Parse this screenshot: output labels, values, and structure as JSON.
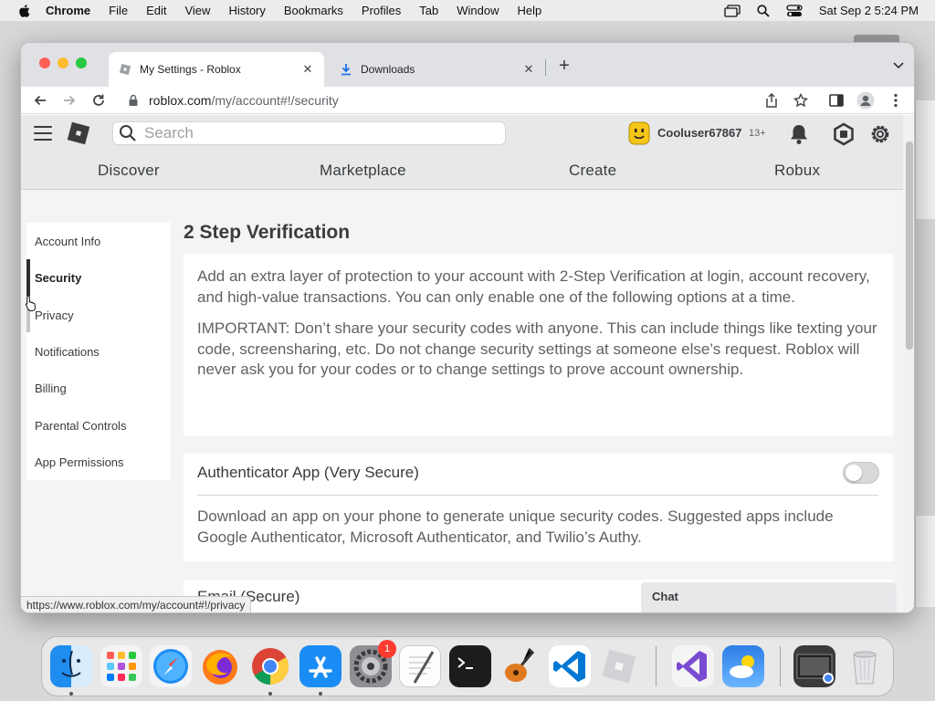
{
  "menubar": {
    "app": "Chrome",
    "items": [
      "File",
      "Edit",
      "View",
      "History",
      "Bookmarks",
      "Profiles",
      "Tab",
      "Window",
      "Help"
    ],
    "clock": "Sat Sep 2  5:24 PM"
  },
  "browser": {
    "tabs": [
      {
        "title": "My Settings - Roblox",
        "active": true
      },
      {
        "title": "Downloads",
        "active": false
      }
    ],
    "url_host": "roblox.com",
    "url_path": "/my/account#!/security",
    "status_url": "https://www.roblox.com/my/account#!/privacy"
  },
  "header": {
    "search_placeholder": "Search",
    "username": "Cooluser67867",
    "age_badge": "13+"
  },
  "nav": {
    "items": [
      "Discover",
      "Marketplace",
      "Create",
      "Robux"
    ]
  },
  "sidebar": {
    "items": [
      {
        "label": "Account Info"
      },
      {
        "label": "Security"
      },
      {
        "label": "Privacy"
      },
      {
        "label": "Notifications"
      },
      {
        "label": "Billing"
      },
      {
        "label": "Parental Controls"
      },
      {
        "label": "App Permissions"
      }
    ],
    "active": "Security"
  },
  "main": {
    "title": "2 Step Verification",
    "intro": "Add an extra layer of protection to your account with 2-Step Verification at login, account recovery, and high-value transactions. You can only enable one of the following options at a time.",
    "important": "IMPORTANT: Don’t share your security codes with anyone. This can include things like texting your code, screensharing, etc. Do not change security settings at someone else’s request. Roblox will never ask you for your codes or to change settings to prove account ownership.",
    "authenticator": {
      "title": "Authenticator App (Very Secure)",
      "enabled": false,
      "description": "Download an app on your phone to generate unique security codes. Suggested apps include Google Authenticator, Microsoft Authenticator, and Twilio’s Authy."
    },
    "email": {
      "title": "Email (Secure)"
    }
  },
  "chat": {
    "label": "Chat"
  },
  "dock": {
    "apps": [
      "finder-icon",
      "launchpad-icon",
      "safari-icon",
      "firefox-icon",
      "chrome-icon",
      "app-store-icon",
      "system-settings-icon",
      "textedit-icon",
      "terminal-icon",
      "garageband-icon",
      "vscode-icon",
      "roblox-studio-icon",
      "visual-studio-icon",
      "weather-icon",
      "downloads-folder-icon",
      "trash-icon"
    ],
    "settings_badge": "1"
  },
  "colors": {
    "roblox_header": "#e6e8ea",
    "page_background": "#f2f4f5",
    "sidebar_indicator": "#2b2d2f",
    "text_primary": "#393b3d"
  }
}
